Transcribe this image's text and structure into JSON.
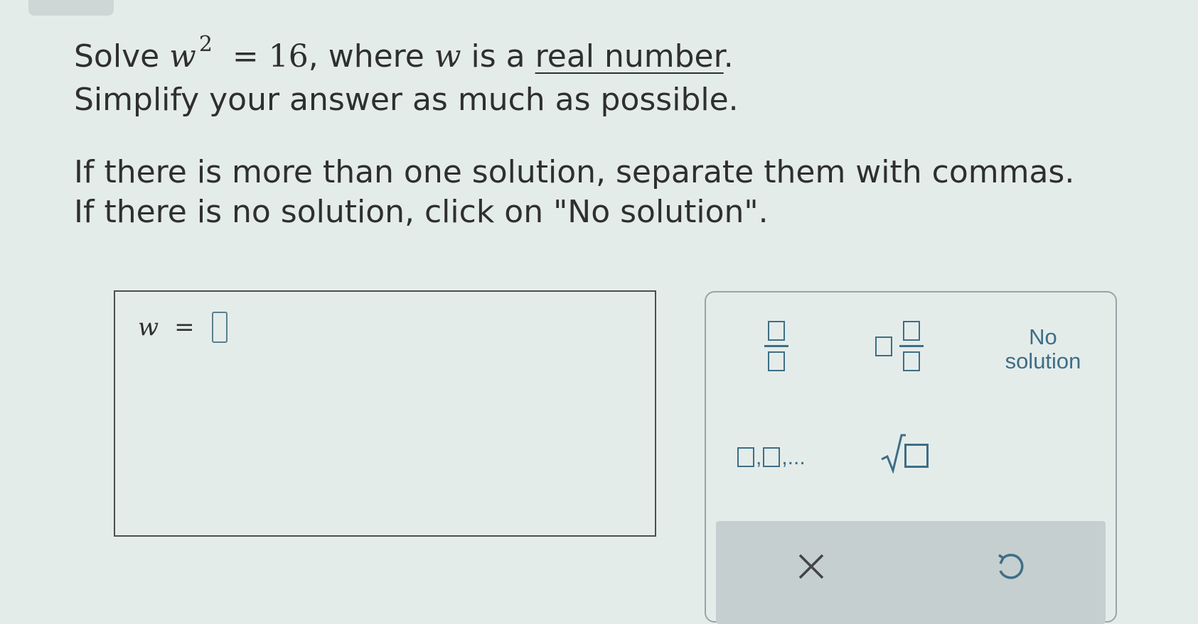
{
  "question": {
    "prefix": "Solve ",
    "variable": "w",
    "exponent": "2",
    "equals_value": "= 16",
    "mid": ", where ",
    "variable2": "w",
    "is_a": " is a ",
    "link_text": "real number",
    "end_period": ".",
    "simplify": "Simplify your answer as much as possible.",
    "instruction1": "If there is more than one solution, separate them with commas.",
    "instruction2": "If there is no solution, click on \"No solution\"."
  },
  "answer": {
    "variable": "w",
    "equals": "=",
    "value": ""
  },
  "keypad": {
    "no_solution_line1": "No",
    "no_solution_line2": "solution",
    "list_comma": ",",
    "list_ellipsis": ",..."
  },
  "icons": {
    "fraction": "fraction-icon",
    "mixed": "mixed-number-icon",
    "list": "list-icon",
    "sqrt": "sqrt-icon",
    "clear": "clear-icon",
    "undo": "undo-icon"
  },
  "colors": {
    "accent": "#3d6e86",
    "text": "#2f2f2f",
    "action_bar": "#c5cfcf"
  }
}
